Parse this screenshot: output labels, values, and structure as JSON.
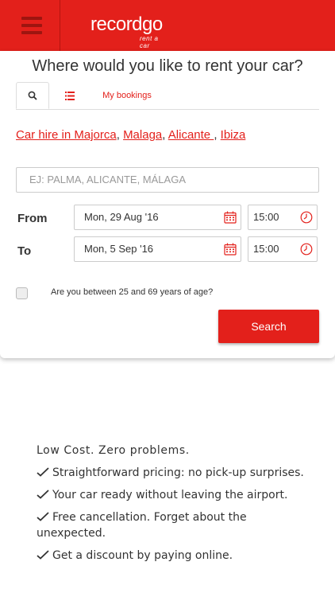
{
  "header": {
    "brand_name": "recordgo",
    "brand_tagline": "rent a car",
    "menu_icon": "hamburger-menu-icon",
    "brand_color": "#e3201b"
  },
  "search": {
    "title": "Where would you like to rent your car?",
    "tabs": [
      {
        "icon": "search-icon"
      },
      {
        "icon": "list-icon"
      },
      {
        "label": "My bookings"
      }
    ],
    "quick_links": [
      "Car hire in Majorca",
      "Malaga",
      "Alicante ",
      "Ibiza"
    ],
    "location_placeholder": "EJ: PALMA, ALICANTE, MÁLAGA",
    "from_label": "From",
    "to_label": "To",
    "from_date": "Mon, 29 Aug '16",
    "from_time": "15:00",
    "to_date": "Mon, 5 Sep '16",
    "to_time": "15:00",
    "age_question": "Are you between 25 and 69 years of age?",
    "search_button": "Search"
  },
  "features": {
    "heading": "Low Cost. Zero problems.",
    "items": [
      "Straightforward pricing: no pick-up surprises.",
      "Your car ready without leaving the airport.",
      "Free cancellation. Forget about the unexpected.",
      "Get a discount by paying online."
    ]
  }
}
